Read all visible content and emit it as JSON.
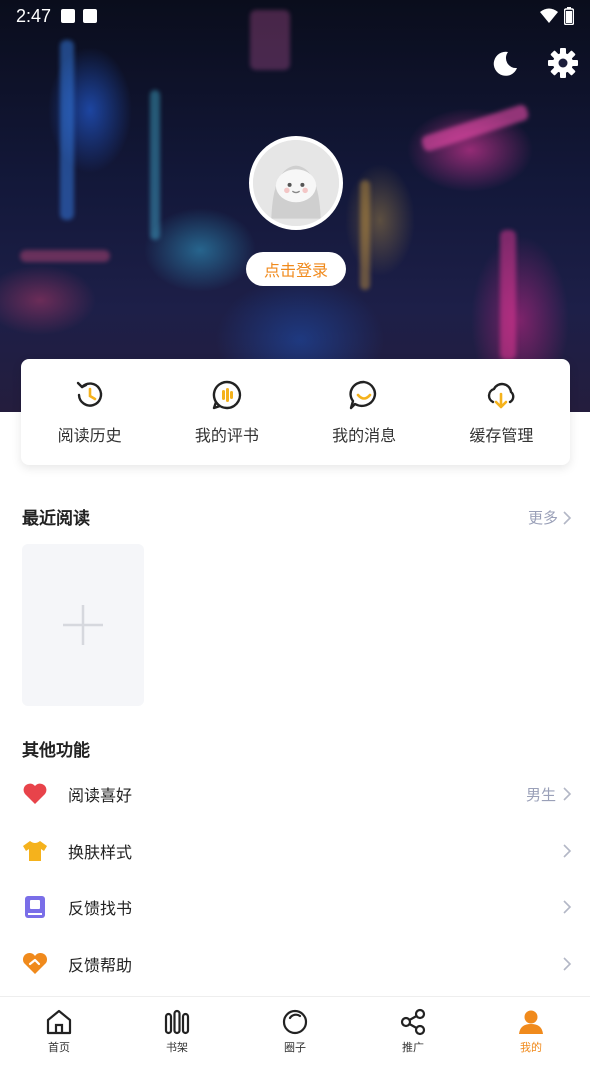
{
  "status_bar": {
    "time": "2:47"
  },
  "header": {
    "login_button": "点击登录"
  },
  "quick_actions": [
    {
      "label": "阅读历史",
      "icon": "history-icon"
    },
    {
      "label": "我的评书",
      "icon": "review-icon"
    },
    {
      "label": "我的消息",
      "icon": "message-icon"
    },
    {
      "label": "缓存管理",
      "icon": "cloud-download-icon"
    }
  ],
  "recent": {
    "title": "最近阅读",
    "more": "更多"
  },
  "other": {
    "title": "其他功能",
    "items": [
      {
        "label": "阅读喜好",
        "value": "男生",
        "icon": "heart-icon",
        "color": "#e8434a"
      },
      {
        "label": "换肤样式",
        "value": "",
        "icon": "shirt-icon",
        "color": "#f5b21c"
      },
      {
        "label": "反馈找书",
        "value": "",
        "icon": "book-icon",
        "color": "#7a6ee8"
      },
      {
        "label": "反馈帮助",
        "value": "",
        "icon": "help-heart-icon",
        "color": "#f08a1c"
      }
    ]
  },
  "bottom_nav": [
    {
      "label": "首页",
      "icon": "home-icon"
    },
    {
      "label": "书架",
      "icon": "bookshelf-icon"
    },
    {
      "label": "圈子",
      "icon": "circle-icon"
    },
    {
      "label": "推广",
      "icon": "share-icon"
    },
    {
      "label": "我的",
      "icon": "user-icon",
      "active": true
    }
  ],
  "colors": {
    "accent": "#f08a1c",
    "muted": "#9aa0b8"
  }
}
